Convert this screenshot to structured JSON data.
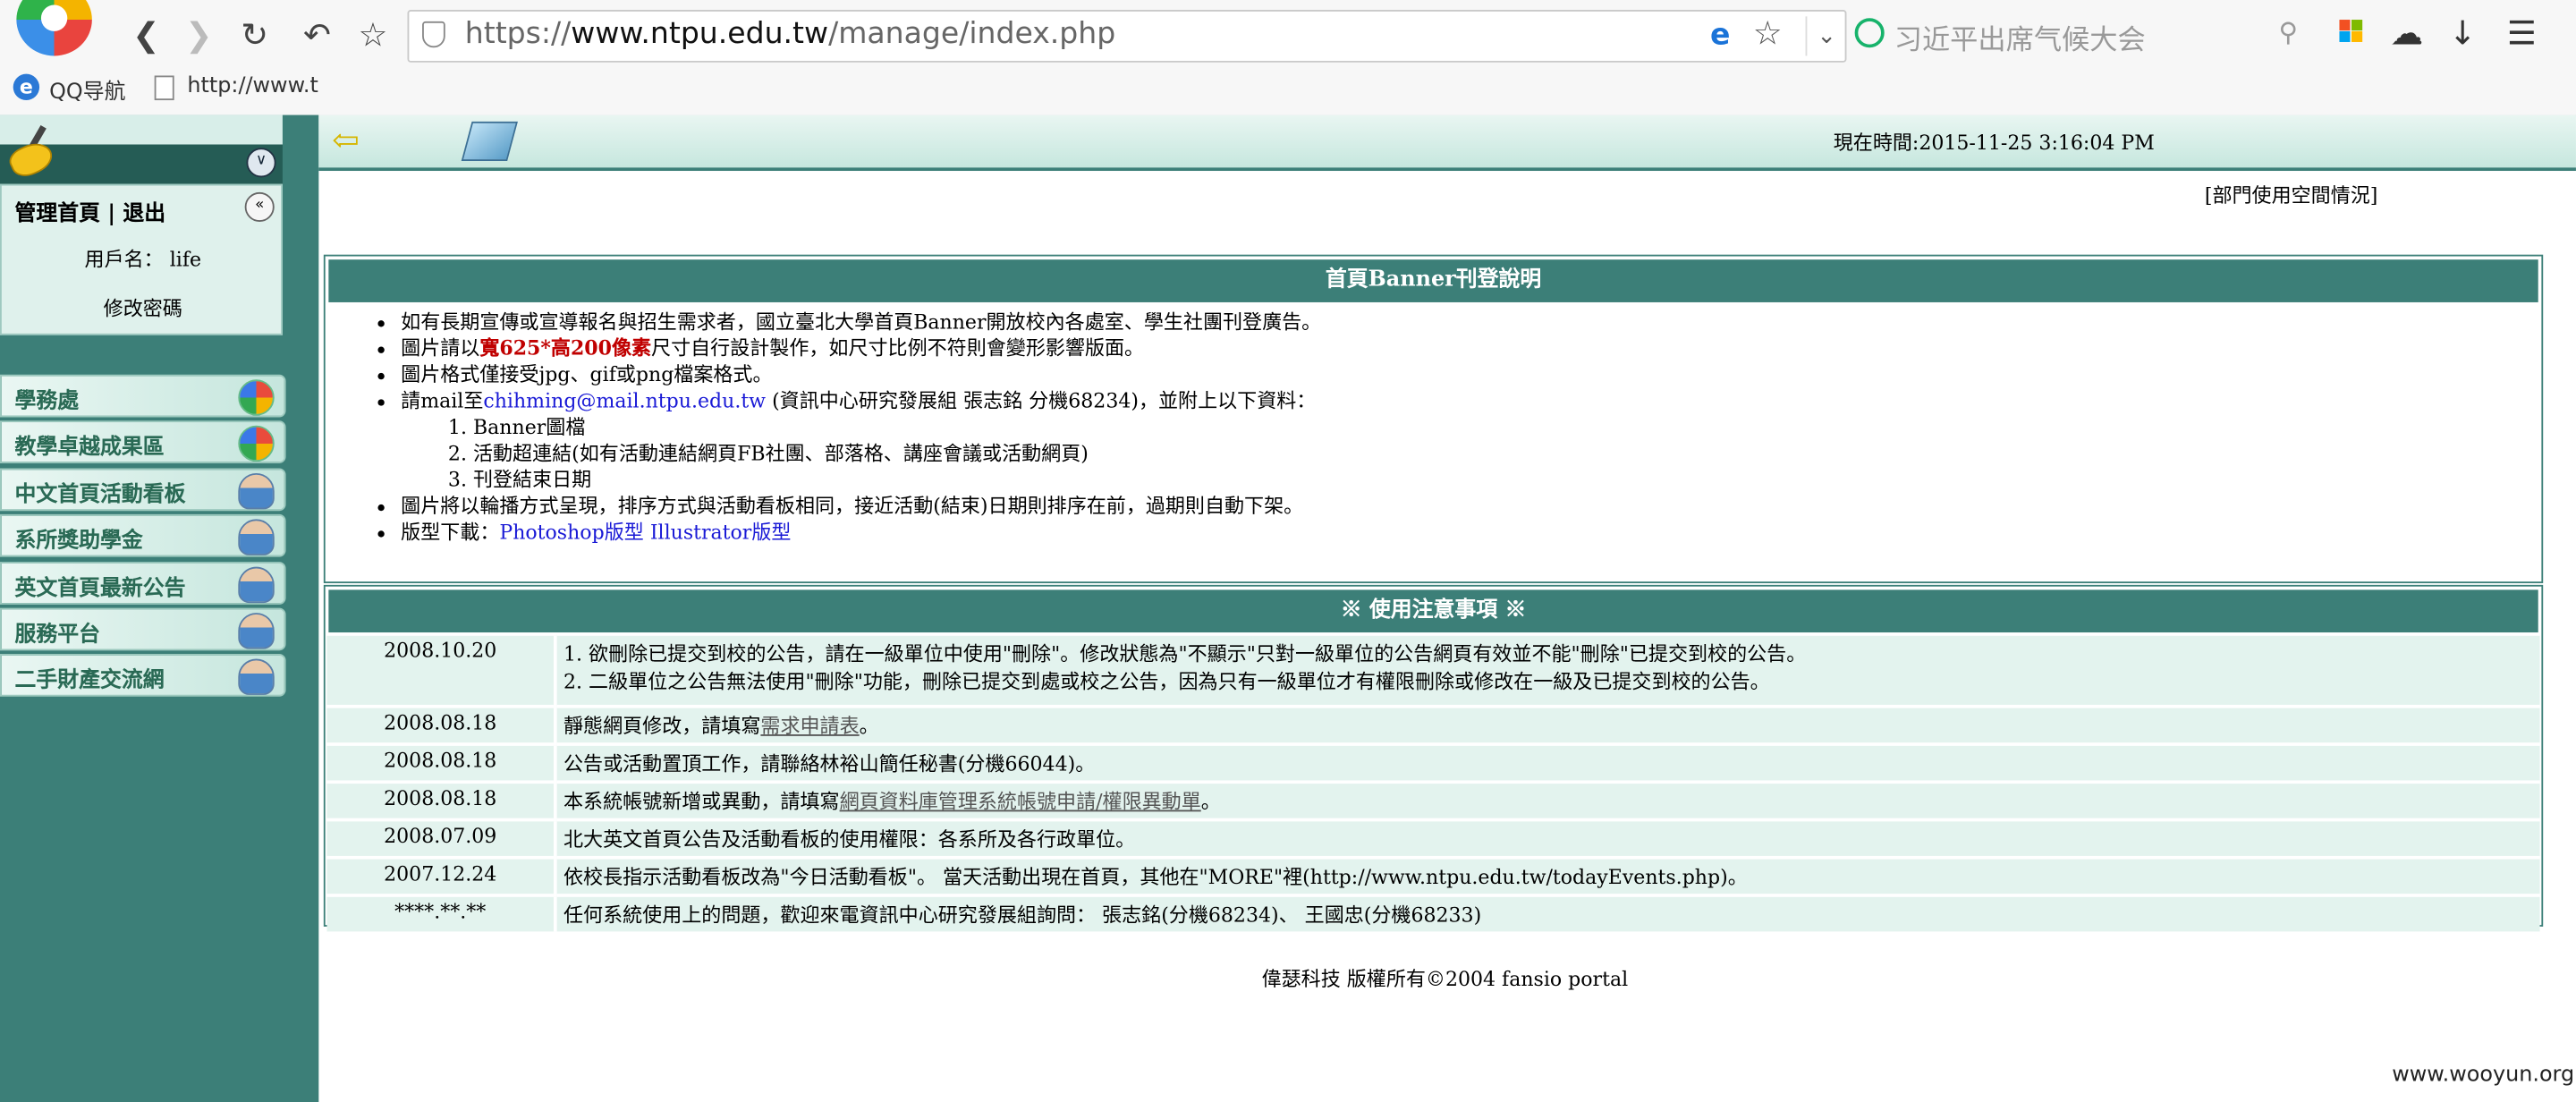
{
  "browser": {
    "url_prefix": "https://",
    "url_host": "www.ntpu.edu.tw",
    "url_path": "/manage/index.php",
    "search_placeholder": "习近平出席气候大会",
    "bookmarks": [
      {
        "label": "QQ导航"
      },
      {
        "label": "http://www.t"
      }
    ]
  },
  "sidebar": {
    "panel_title": "管理首頁",
    "panel_logout": "退出",
    "user_label": "用戶名：",
    "user_name": "life",
    "change_password": "修改密碼",
    "items": [
      {
        "label": "學務處",
        "icon": "globe-icon"
      },
      {
        "label": "教學卓越成果區",
        "icon": "globe-icon"
      },
      {
        "label": "中文首頁活動看板",
        "icon": "people-icon"
      },
      {
        "label": "系所獎助學金",
        "icon": "people-icon"
      },
      {
        "label": "英文首頁最新公告",
        "icon": "people-icon"
      },
      {
        "label": "服務平台",
        "icon": "people-icon"
      },
      {
        "label": "二手財產交流網",
        "icon": "people-icon"
      }
    ]
  },
  "header": {
    "clock": "現在時間:2015-11-25 3:16:04 PM",
    "space_link": "[部門使用空間情況]"
  },
  "banner": {
    "title": "首頁Banner刊登說明",
    "b1": "如有長期宣傳或宣導報名與招生需求者，國立臺北大學首頁Banner開放校內各處室、學生社團刊登廣告。",
    "b2_pre": "圖片請以",
    "b2_red": "寬625*高200像素",
    "b2_post": "尺寸自行設計製作，如尺寸比例不符則會變形影響版面。",
    "b3": "圖片格式僅接受jpg、gif或png檔案格式。",
    "b4_pre": "請mail至",
    "b4_email": "chihming@mail.ntpu.edu.tw",
    "b4_post": " (資訊中心研究發展組 張志銘 分機68234)，並附上以下資料：",
    "sub": [
      "Banner圖檔",
      "活動超連結(如有活動連結網頁FB社團、部落格、講座會議或活動網頁)",
      "刊登結束日期"
    ],
    "b5": "圖片將以輪播方式呈現，排序方式與活動看板相同，接近活動(結束)日期則排序在前，過期則自動下架。",
    "b6_pre": "版型下載：",
    "b6_link1": "Photoshop版型",
    "b6_link2": "Illustrator版型"
  },
  "notes": {
    "title": "※ 使用注意事項 ※",
    "rows": [
      {
        "date": "2008.10.20",
        "line1": "1. 欲刪除已提交到校的公告，請在一級單位中使用\"刪除\"。修改狀態為\"不顯示\"只對一級單位的公告網頁有效並不能\"刪除\"已提交到校的公告。",
        "line2": "2. 二級單位之公告無法使用\"刪除\"功能，刪除已提交到處或校之公告，因為只有一級單位才有權限刪除或修改在一級及已提交到校的公告。"
      },
      {
        "date": "2008.08.18",
        "pre": "靜態網頁修改，請填寫",
        "link": "需求申請表",
        "post": "。"
      },
      {
        "date": "2008.08.18",
        "text": "公告或活動置頂工作，請聯絡林裕山簡任秘書(分機66044)。"
      },
      {
        "date": "2008.08.18",
        "pre": "本系統帳號新增或異動，請填寫",
        "link": "網頁資料庫管理系統帳號申請/權限異動單",
        "post": "。"
      },
      {
        "date": "2008.07.09",
        "text": "北大英文首頁公告及活動看板的使用權限：各系所及各行政單位。"
      },
      {
        "date": "2007.12.24",
        "text": "依校長指示活動看板改為\"今日活動看板\"。 當天活動出現在首頁，其他在\"MORE\"裡(http://www.ntpu.edu.tw/todayEvents.php)。"
      },
      {
        "date": "****.**.**",
        "text": "任何系統使用上的問題，歡迎來電資訊中心研究發展組詢問： 張志銘(分機68234)、 王國忠(分機68233)"
      }
    ]
  },
  "footer": "偉瑟科技 版權所有©2004 fansio portal",
  "watermark": "www.wooyun.org"
}
